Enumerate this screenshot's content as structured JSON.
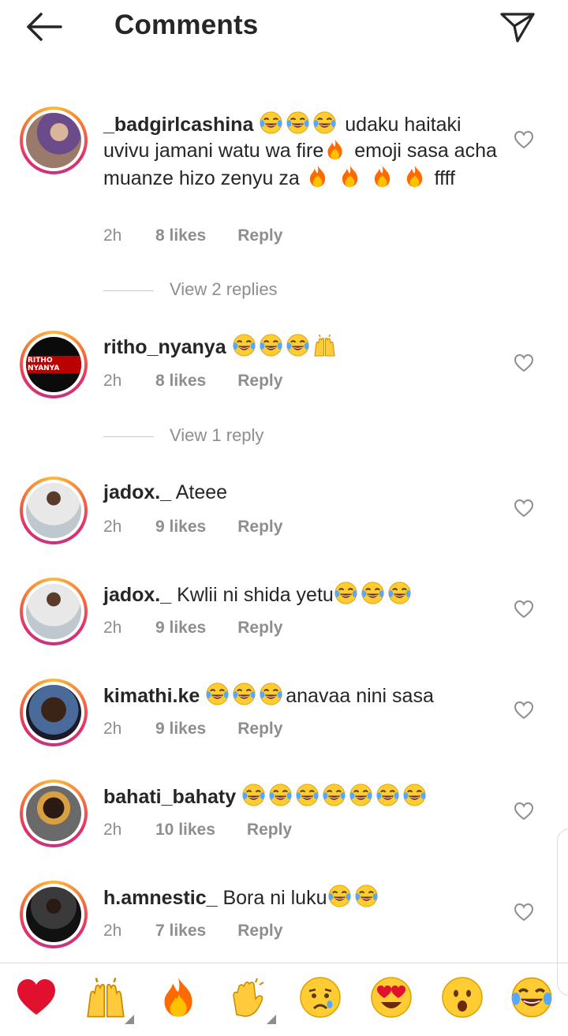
{
  "header": {
    "title": "Comments"
  },
  "comments": [
    {
      "username": "_badgirlcashina",
      "text_a": "udaku haitaki uvivu jamani watu wa fire",
      "text_b": " emoji sasa acha muanze hizo zenyu za ",
      "text_c": " ffff",
      "time": "2h",
      "likes": "8 likes",
      "reply": "Reply"
    },
    {
      "username": "ritho_nyanya",
      "text": "",
      "time": "2h",
      "likes": "8 likes",
      "reply": "Reply",
      "avatar_text": "RITHO NYANYA"
    },
    {
      "username": "jadox._",
      "text": "Ateee",
      "time": "2h",
      "likes": "9 likes",
      "reply": "Reply"
    },
    {
      "username": "jadox._",
      "text": "Kwlii ni shida yetu",
      "time": "2h",
      "likes": "9 likes",
      "reply": "Reply"
    },
    {
      "username": "kimathi.ke",
      "text": "anavaa nini sasa",
      "time": "2h",
      "likes": "9 likes",
      "reply": "Reply"
    },
    {
      "username": "bahati_bahaty",
      "text": "",
      "time": "2h",
      "likes": "10 likes",
      "reply": "Reply"
    },
    {
      "username": "h.amnestic_",
      "text": "Bora ni luku",
      "time": "2h",
      "likes": "7 likes",
      "reply": "Reply"
    }
  ],
  "view_replies": [
    "View 2 replies",
    "View 1 reply"
  ],
  "emoji_bar": [
    "red-heart",
    "raising-hands",
    "fire",
    "clapping-hands",
    "crying-face",
    "heart-eyes",
    "surprised-face",
    "tears-of-joy"
  ],
  "colors": {
    "accent_text": "#262626",
    "muted": "#8e8e8e",
    "heart_red": "#e0102e"
  }
}
